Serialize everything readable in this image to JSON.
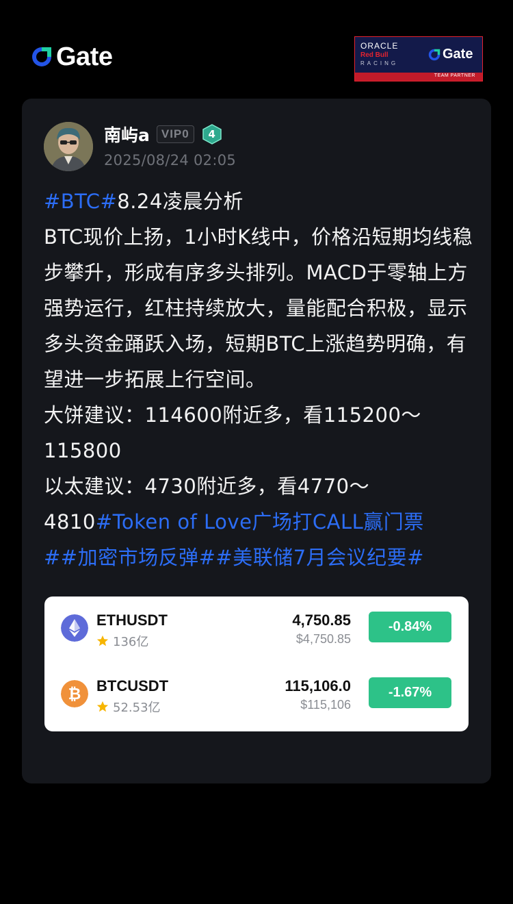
{
  "header": {
    "logo_text": "Gate",
    "logo_color": "#2354e6",
    "partner": {
      "oracle": "ORACLE",
      "redbull": "Red Bull",
      "racing": "RACING",
      "gate": "Gate",
      "strip": "TEAM PARTNER"
    }
  },
  "post": {
    "username": "南屿a",
    "vip": "VIP0",
    "level": "4",
    "timestamp": "2025/08/24 02:05",
    "tag_btc": "#BTC#",
    "title": "8.24凌晨分析",
    "body": "BTC现价上扬，1小时K线中，价格沿短期均线稳步攀升，形成有序多头排列。MACD于零轴上方强势运行，红柱持续放大，量能配合积极，显示多头资金踊跃入场，短期BTC上涨趋势明确，有望进一步拓展上行空间。",
    "btc_advice": "大饼建议：114600附近多，看115200～115800",
    "eth_advice_1": "以太建议：4730附近多，看4770～",
    "eth_advice_2": "4810",
    "tag_token": "#Token of Love广场打CALL赢门票",
    "tag_market": "##加密市场反弹##美联储7月会议纪要#",
    "tag_color": "#2c6df5"
  },
  "tickers": [
    {
      "pair": "ETHUSDT",
      "volume": "136亿",
      "price": "4,750.85",
      "usd": "$4,750.85",
      "change": "-0.84%",
      "icon": "eth-icon",
      "icon_color": "#5e6bd9"
    },
    {
      "pair": "BTCUSDT",
      "volume": "52.53亿",
      "price": "115,106.0",
      "usd": "$115,106",
      "change": "-1.67%",
      "icon": "btc-icon",
      "icon_color": "#f0913a"
    }
  ],
  "colors": {
    "change_bg": "#2dc288",
    "star": "#f7b500"
  }
}
